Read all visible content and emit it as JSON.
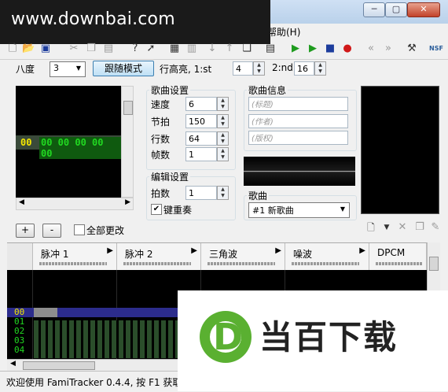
{
  "watermark": {
    "text": "www.downbai.com"
  },
  "window": {
    "min_glyph": "─",
    "max_glyph": "▢",
    "close_glyph": "✕"
  },
  "menu": {
    "help": "帮助(H)"
  },
  "toolbar": {
    "icons": [
      "new-file-icon",
      "open-file-icon",
      "save-icon",
      "cut-icon",
      "copy-icon",
      "paste-icon",
      "help-icon",
      "pointer-icon",
      "insert-frame-icon",
      "remove-frame-icon",
      "move-down-icon",
      "move-up-icon",
      "duplicate-icon",
      "module-props-icon",
      "play-icon",
      "play-loop-icon",
      "stop-icon",
      "record-icon",
      "prev-track-icon",
      "next-track-icon",
      "settings-icon",
      "nsf-export-icon"
    ],
    "nsf_label": "NSF"
  },
  "row2": {
    "octave_label": "八度",
    "octave_value": "3",
    "follow_mode": "跟随模式",
    "highlight_label": "行高亮, 1:st",
    "highlight1_value": "4",
    "highlight2_label": "2:nd",
    "highlight2_value": "16"
  },
  "frame_editor": {
    "row_number": "00",
    "row_values": "00 00 00 00 00",
    "add_label": "+",
    "remove_label": "-",
    "change_all_label": "全部更改"
  },
  "song_settings": {
    "title": "歌曲设置",
    "fields": [
      {
        "label": "速度",
        "value": "6"
      },
      {
        "label": "节拍",
        "value": "150"
      },
      {
        "label": "行数",
        "value": "64"
      },
      {
        "label": "帧数",
        "value": "1"
      }
    ]
  },
  "edit_settings": {
    "title": "编辑设置",
    "step_label": "拍数",
    "step_value": "1",
    "repeat_label": "键重奏",
    "repeat_checked": true
  },
  "song_info": {
    "title": "歌曲信息",
    "title_placeholder": "(标题)",
    "author_placeholder": "(作者)",
    "copyright_placeholder": "(版权)"
  },
  "song": {
    "label": "歌曲",
    "selected": "#1  新歌曲"
  },
  "channels": [
    {
      "name": "脉冲 1"
    },
    {
      "name": "脉冲 2"
    },
    {
      "name": "三角波"
    },
    {
      "name": "噪波"
    },
    {
      "name": "DPCM"
    }
  ],
  "pattern_rows": [
    "00",
    "01",
    "02",
    "03",
    "04"
  ],
  "status": {
    "text": "欢迎使用 FamiTracker 0.4.4, 按 F1 获取"
  },
  "logo": {
    "text": "当百下载",
    "mark": "D"
  },
  "colors": {
    "accent_green": "#5ab031",
    "frame_text": "#21d821",
    "row_text": "#f5e800"
  }
}
